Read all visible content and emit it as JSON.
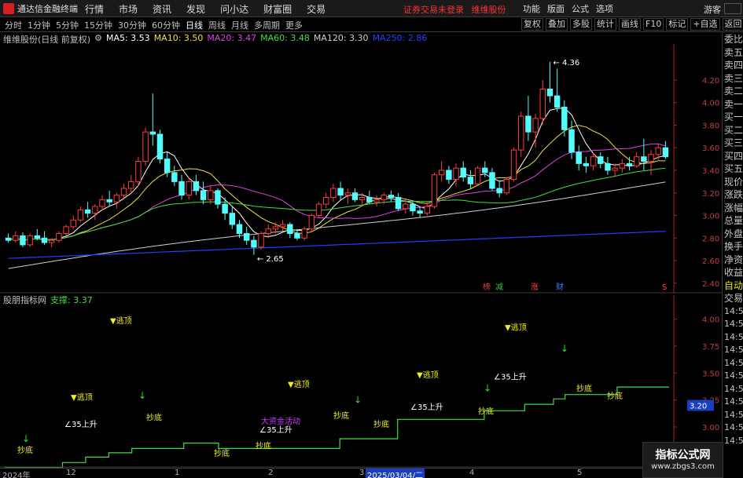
{
  "titlebar": {
    "app_title": "通达信金融终端",
    "menu": [
      "行情",
      "市场",
      "资讯",
      "发现",
      "问小达",
      "财富圈",
      "交易"
    ],
    "login_warning": "证券交易未登录",
    "stock_name": "维维股份",
    "right_menu": [
      "功能",
      "版面",
      "公式",
      "选项"
    ],
    "guest": "游客"
  },
  "period_tabs": [
    "分时",
    "1分钟",
    "5分钟",
    "15分钟",
    "30分钟",
    "60分钟",
    "日线",
    "周线",
    "月线",
    "多周期",
    "更多"
  ],
  "active_period": "日线",
  "tools": [
    "复权",
    "叠加",
    "多股",
    "统计",
    "画线",
    "F10",
    "标记",
    "+自选",
    "返回"
  ],
  "main_chart": {
    "title": "维维股份(日线 前复权)",
    "ma": [
      {
        "label": "MA5: 3.53",
        "color": "#ffffff"
      },
      {
        "label": "MA10: 3.50",
        "color": "#f0e040"
      },
      {
        "label": "MA20: 3.47",
        "color": "#e040e0"
      },
      {
        "label": "MA60: 3.48",
        "color": "#40e040"
      },
      {
        "label": "MA120: 3.30",
        "color": "#d0d0d0"
      },
      {
        "label": "MA250: 2.86",
        "color": "#2040ff"
      }
    ],
    "high_label": "4.36",
    "low_label": "2.65",
    "event_marks": [
      {
        "text": "榜",
        "color": "#d04040"
      },
      {
        "text": "减",
        "color": "#40c040"
      },
      {
        "text": "涨",
        "color": "#ff4040"
      },
      {
        "text": "财",
        "color": "#4080ff"
      },
      {
        "text": "S",
        "color": "#ff4040"
      }
    ],
    "y_ticks": [
      "4.20",
      "4.00",
      "3.80",
      "3.60",
      "3.40",
      "3.20",
      "3.00",
      "2.80",
      "2.60",
      "2.40"
    ]
  },
  "sub_chart": {
    "title": "股朋指标网",
    "support": "支撑: 3.37",
    "y_ticks": [
      "4.00",
      "3.75",
      "3.50",
      "3.25",
      "3.00",
      "2.75"
    ],
    "current_value": "3.20",
    "labels": {
      "escape_top": "逃顶",
      "bottom_buy": "抄底",
      "up35": "35上升",
      "capital": "大资金活动"
    }
  },
  "right_panel": {
    "rows": [
      "委比",
      "卖五",
      "卖四",
      "卖三",
      "卖二",
      "卖一",
      "买一",
      "买二",
      "买三",
      "买四",
      "买五",
      "现价",
      "涨跌",
      "涨幅",
      "总量",
      "外盘",
      "换手",
      "净资",
      "收益"
    ],
    "auto": "自动",
    "trade": "交易",
    "times": [
      "14:56",
      "14:56",
      "14:56",
      "14:56",
      "14:56",
      "14:56",
      "14:56",
      "14:56",
      "14:56",
      "14:56",
      "14:56"
    ]
  },
  "watermark": {
    "title": "指标公式网",
    "url": "www.zbgs3.com"
  },
  "time_axis": [
    "2024年",
    "12",
    "1",
    "2",
    "3",
    "2025/03/04/二",
    "4",
    "5"
  ],
  "chart_data": [
    {
      "type": "candlestick",
      "title": "维维股份(日线 前复权)",
      "ylim": [
        2.35,
        4.45
      ],
      "series": [
        {
          "name": "K线",
          "ohlc": [
            [
              2.8,
              2.84,
              2.76,
              2.78
            ],
            [
              2.78,
              2.86,
              2.76,
              2.82
            ],
            [
              2.82,
              2.85,
              2.72,
              2.74
            ],
            [
              2.74,
              2.84,
              2.72,
              2.82
            ],
            [
              2.82,
              2.88,
              2.78,
              2.8
            ],
            [
              2.8,
              2.86,
              2.74,
              2.76
            ],
            [
              2.76,
              2.8,
              2.72,
              2.78
            ],
            [
              2.78,
              2.86,
              2.76,
              2.84
            ],
            [
              2.84,
              2.92,
              2.82,
              2.9
            ],
            [
              2.9,
              3.0,
              2.88,
              2.96
            ],
            [
              2.96,
              3.08,
              2.94,
              3.05
            ],
            [
              3.05,
              3.12,
              2.98,
              3.02
            ],
            [
              3.02,
              3.1,
              2.96,
              3.08
            ],
            [
              3.08,
              3.18,
              3.04,
              3.14
            ],
            [
              3.14,
              3.22,
              3.08,
              3.12
            ],
            [
              3.12,
              3.2,
              3.06,
              3.18
            ],
            [
              3.18,
              3.28,
              3.14,
              3.24
            ],
            [
              3.24,
              3.36,
              3.2,
              3.3
            ],
            [
              3.3,
              3.52,
              3.26,
              3.48
            ],
            [
              3.48,
              3.78,
              3.44,
              3.74
            ],
            [
              3.74,
              4.08,
              3.62,
              3.72
            ],
            [
              3.72,
              3.76,
              3.46,
              3.5
            ],
            [
              3.5,
              3.56,
              3.34,
              3.38
            ],
            [
              3.38,
              3.44,
              3.26,
              3.3
            ],
            [
              3.3,
              3.36,
              3.14,
              3.18
            ],
            [
              3.18,
              3.34,
              3.14,
              3.3
            ],
            [
              3.3,
              3.36,
              3.18,
              3.22
            ],
            [
              3.22,
              3.3,
              3.1,
              3.14
            ],
            [
              3.14,
              3.26,
              3.1,
              3.22
            ],
            [
              3.22,
              3.24,
              3.06,
              3.1
            ],
            [
              3.1,
              3.16,
              2.96,
              3.02
            ],
            [
              3.02,
              3.08,
              2.88,
              2.92
            ],
            [
              2.92,
              2.96,
              2.8,
              2.84
            ],
            [
              2.84,
              2.9,
              2.74,
              2.78
            ],
            [
              2.78,
              2.82,
              2.65,
              2.72
            ],
            [
              2.72,
              2.86,
              2.7,
              2.84
            ],
            [
              2.84,
              2.92,
              2.8,
              2.88
            ],
            [
              2.88,
              2.94,
              2.84,
              2.9
            ],
            [
              2.9,
              2.96,
              2.86,
              2.92
            ],
            [
              2.92,
              2.94,
              2.8,
              2.84
            ],
            [
              2.84,
              2.88,
              2.78,
              2.8
            ],
            [
              2.8,
              2.9,
              2.78,
              2.88
            ],
            [
              2.88,
              3.02,
              2.86,
              3.0
            ],
            [
              3.0,
              3.12,
              2.98,
              3.1
            ],
            [
              3.1,
              3.2,
              3.06,
              3.16
            ],
            [
              3.16,
              3.28,
              3.12,
              3.24
            ],
            [
              3.24,
              3.3,
              3.14,
              3.18
            ],
            [
              3.18,
              3.24,
              3.1,
              3.2
            ],
            [
              3.2,
              3.24,
              3.12,
              3.14
            ],
            [
              3.14,
              3.2,
              3.08,
              3.16
            ],
            [
              3.16,
              3.22,
              3.1,
              3.12
            ],
            [
              3.12,
              3.18,
              3.08,
              3.14
            ],
            [
              3.14,
              3.2,
              3.1,
              3.18
            ],
            [
              3.18,
              3.22,
              3.12,
              3.16
            ],
            [
              3.16,
              3.2,
              3.04,
              3.06
            ],
            [
              3.06,
              3.14,
              3.02,
              3.1
            ],
            [
              3.1,
              3.12,
              3.0,
              3.04
            ],
            [
              3.04,
              3.08,
              2.98,
              3.02
            ],
            [
              3.02,
              3.12,
              3.0,
              3.08
            ],
            [
              3.08,
              3.38,
              3.06,
              3.36
            ],
            [
              3.36,
              3.48,
              3.3,
              3.4
            ],
            [
              3.4,
              3.44,
              3.28,
              3.32
            ],
            [
              3.32,
              3.46,
              3.26,
              3.42
            ],
            [
              3.42,
              3.48,
              3.3,
              3.34
            ],
            [
              3.34,
              3.4,
              3.24,
              3.28
            ],
            [
              3.28,
              3.44,
              3.26,
              3.42
            ],
            [
              3.42,
              3.48,
              3.34,
              3.38
            ],
            [
              3.38,
              3.42,
              3.22,
              3.24
            ],
            [
              3.24,
              3.3,
              3.16,
              3.2
            ],
            [
              3.2,
              3.34,
              3.18,
              3.32
            ],
            [
              3.32,
              3.6,
              3.3,
              3.58
            ],
            [
              3.58,
              3.92,
              3.52,
              3.88
            ],
            [
              3.88,
              4.06,
              3.66,
              3.74
            ],
            [
              3.74,
              3.9,
              3.6,
              3.86
            ],
            [
              3.86,
              4.2,
              3.8,
              4.12
            ],
            [
              4.12,
              4.36,
              4.0,
              4.06
            ],
            [
              4.06,
              4.3,
              3.92,
              3.96
            ],
            [
              3.96,
              4.02,
              3.7,
              3.76
            ],
            [
              3.76,
              3.84,
              3.5,
              3.56
            ],
            [
              3.56,
              3.62,
              3.4,
              3.46
            ],
            [
              3.46,
              3.52,
              3.38,
              3.44
            ],
            [
              3.44,
              3.56,
              3.4,
              3.52
            ],
            [
              3.52,
              3.56,
              3.42,
              3.46
            ],
            [
              3.46,
              3.52,
              3.36,
              3.4
            ],
            [
              3.4,
              3.46,
              3.34,
              3.42
            ],
            [
              3.42,
              3.5,
              3.38,
              3.46
            ],
            [
              3.46,
              3.52,
              3.4,
              3.44
            ],
            [
              3.44,
              3.56,
              3.42,
              3.52
            ],
            [
              3.52,
              3.68,
              3.4,
              3.48
            ],
            [
              3.48,
              3.58,
              3.36,
              3.54
            ],
            [
              3.54,
              3.64,
              3.48,
              3.6
            ],
            [
              3.6,
              3.66,
              3.5,
              3.52
            ]
          ]
        },
        {
          "name": "MA5: 3.53",
          "color": "#ffffff"
        },
        {
          "name": "MA10: 3.50",
          "color": "#f0e040"
        },
        {
          "name": "MA20: 3.47",
          "color": "#e040e0"
        },
        {
          "name": "MA60: 3.48",
          "color": "#40e040"
        },
        {
          "name": "MA120: 3.30",
          "color": "#d0d0d0"
        },
        {
          "name": "MA250: 2.86",
          "color": "#2040ff"
        }
      ]
    },
    {
      "type": "line",
      "title": "股朋指标网",
      "ylim": [
        2.65,
        4.15
      ],
      "series": [
        {
          "name": "支撑: 3.37",
          "color": "#40e040",
          "values": [
            2.62,
            2.62,
            2.62,
            2.62,
            2.62,
            2.62,
            2.62,
            2.62,
            2.62,
            2.62,
            2.67,
            2.67,
            2.67,
            2.67,
            2.72,
            2.72,
            2.72,
            2.72,
            2.76,
            2.76,
            2.76,
            2.76,
            2.8,
            2.8,
            2.8,
            2.8,
            2.8,
            2.8,
            2.8,
            2.8,
            2.8,
            2.85,
            2.85,
            2.85,
            2.85,
            2.85,
            2.85,
            2.8,
            2.8,
            2.8,
            2.8,
            2.8,
            2.8,
            2.8,
            2.8,
            2.8,
            2.8,
            2.8,
            2.8,
            2.8,
            2.8,
            2.8,
            2.8,
            2.8,
            2.8,
            2.8,
            2.8,
            2.8,
            2.89,
            2.89,
            2.89,
            2.89,
            2.89,
            2.89,
            2.89,
            2.89,
            2.89,
            2.89,
            3.07,
            3.07,
            3.07,
            3.07,
            3.07,
            3.07,
            3.07,
            3.07,
            3.07,
            3.07,
            3.07,
            3.07,
            3.07,
            3.07,
            3.07,
            3.15,
            3.15,
            3.15,
            3.15,
            3.15,
            3.15,
            3.15,
            3.21,
            3.21,
            3.21,
            3.21,
            3.21,
            3.26,
            3.26,
            3.3,
            3.3,
            3.3,
            3.3,
            3.3,
            3.3,
            3.3,
            3.3,
            3.3,
            3.37,
            3.37,
            3.37,
            3.37,
            3.37,
            3.37,
            3.37,
            3.37,
            3.37
          ]
        }
      ]
    }
  ]
}
